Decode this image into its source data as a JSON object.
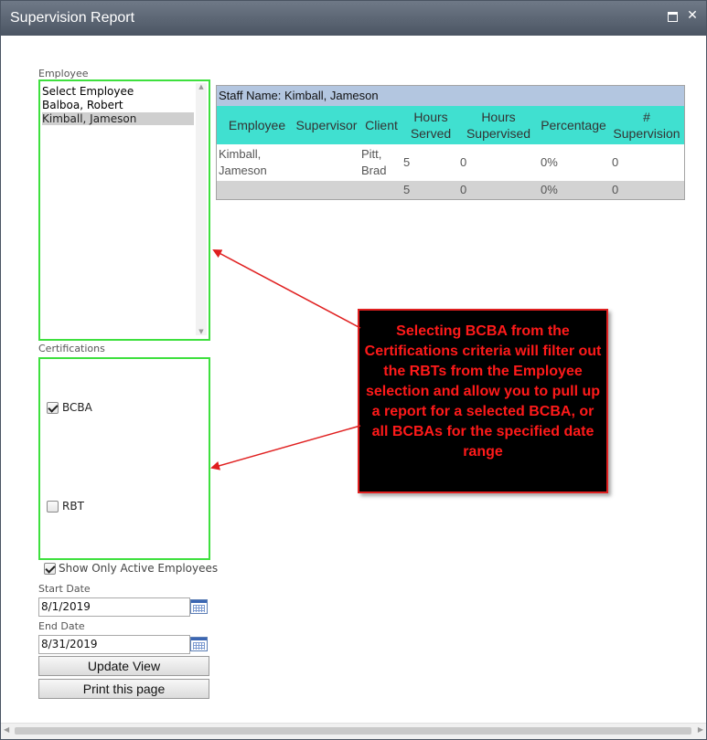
{
  "window": {
    "title": "Supervision Report"
  },
  "employee": {
    "label": "Employee",
    "items": [
      "Select Employee",
      "Balboa, Robert",
      "Kimball, Jameson"
    ],
    "selected_index": 2
  },
  "certifications": {
    "label": "Certifications",
    "options": [
      {
        "label": "BCBA",
        "checked": true
      },
      {
        "label": "RBT",
        "checked": false
      }
    ]
  },
  "active_filter": {
    "label": "Show Only Active Employees",
    "checked": true
  },
  "start_date": {
    "label": "Start Date",
    "value": "8/1/2019"
  },
  "end_date": {
    "label": "End Date",
    "value": "8/31/2019"
  },
  "buttons": {
    "update": "Update View",
    "print": "Print this page"
  },
  "report": {
    "staff_name": "Staff Name: Kimball, Jameson",
    "headers": {
      "employee": "Employee",
      "supervisor": "Supervisor",
      "client": "Client",
      "hours_served": "Hours Served",
      "hours_supervised": "Hours Supervised",
      "percentage": "Percentage",
      "num_supervision": "# Supervision"
    },
    "row": {
      "employee": "Kimball, Jameson",
      "supervisor": "",
      "client": "Pitt, Brad",
      "hours_served": "5",
      "hours_supervised": "0",
      "percentage": "0%",
      "num_supervision": "0"
    },
    "totals": {
      "hours_served": "5",
      "hours_supervised": "0",
      "percentage": "0%",
      "num_supervision": "0"
    }
  },
  "annotation": {
    "text": "Selecting BCBA from the Certifications criteria will filter out the RBTs from the Employee selection and allow you to pull up a report for a selected BCBA, or all BCBAs for the specified date range"
  },
  "colors": {
    "highlight_border": "#3ee03e",
    "header_teal": "#40e0d0",
    "staff_row_blue": "#b3c6e0",
    "callout_text": "#ff1a1a",
    "arrow": "#e02020"
  }
}
